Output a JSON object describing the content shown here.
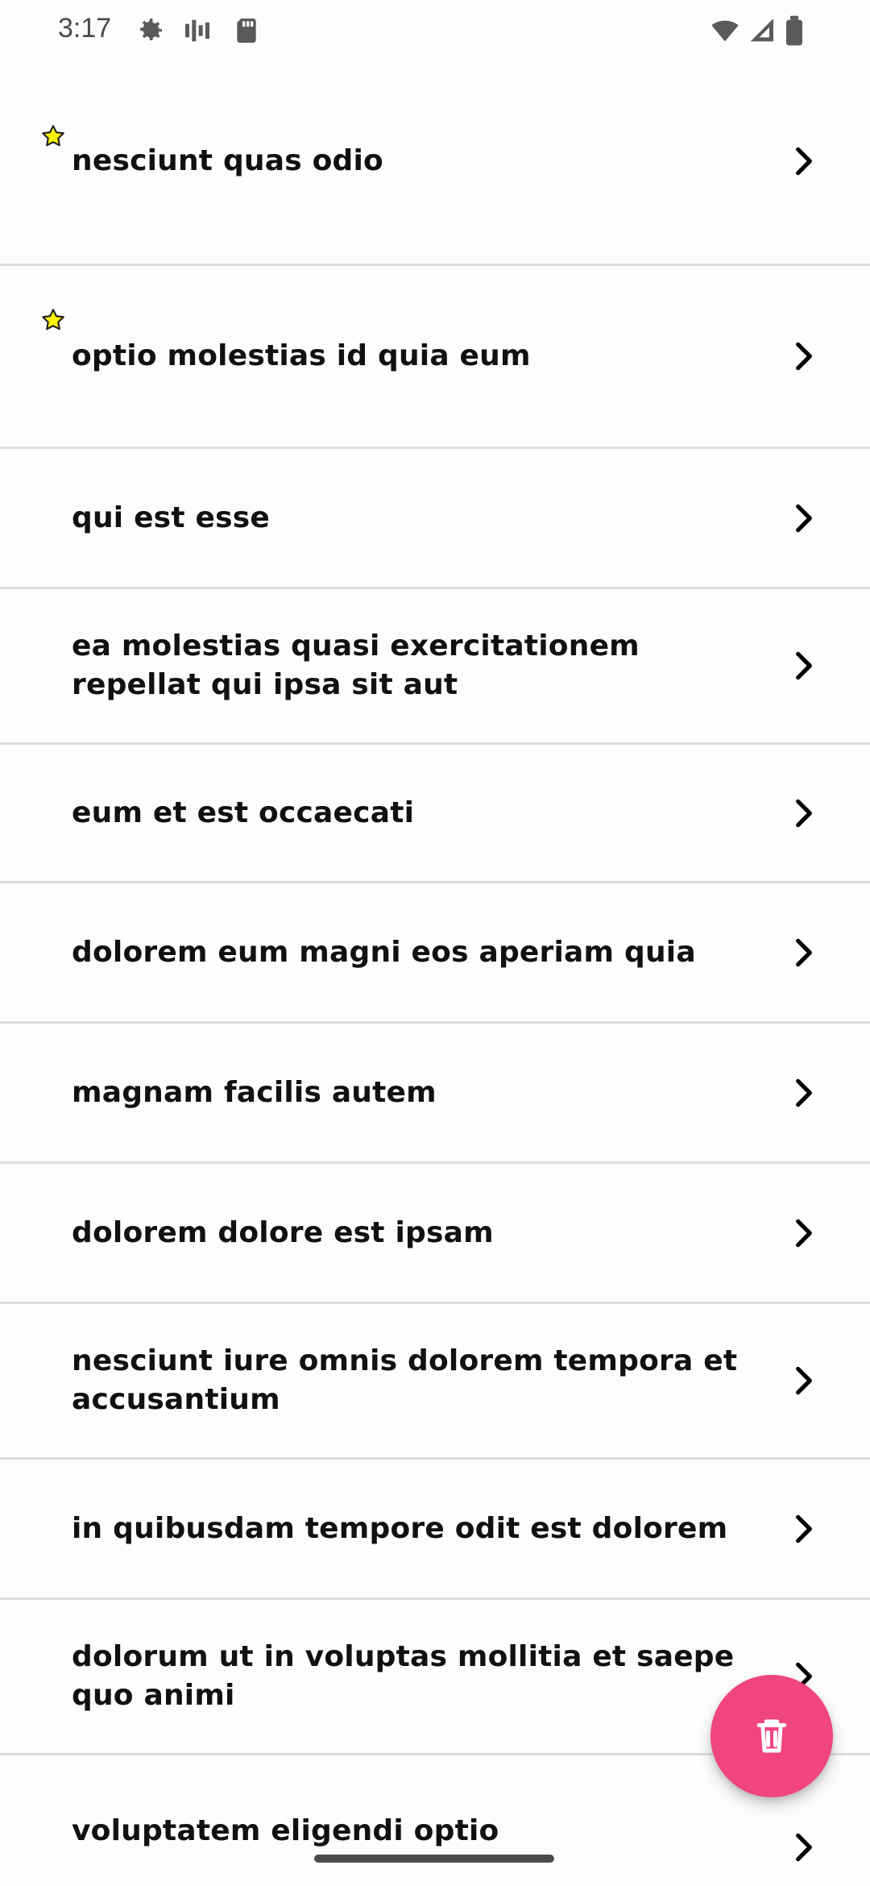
{
  "status_bar": {
    "time": "3:17",
    "left_icons": [
      "settings-icon",
      "signal-bars-icon",
      "sd-card-icon"
    ],
    "right_icons": [
      "wifi-icon",
      "cellular-icon",
      "battery-icon"
    ]
  },
  "list": {
    "items": [
      {
        "title": "nesciunt quas odio",
        "starred": true
      },
      {
        "title": "optio molestias id quia eum",
        "starred": true
      },
      {
        "title": "qui est esse",
        "starred": false
      },
      {
        "title": "ea molestias quasi exercitationem repellat qui ipsa sit aut",
        "starred": false
      },
      {
        "title": "eum et est occaecati",
        "starred": false
      },
      {
        "title": "dolorem eum magni eos aperiam quia",
        "starred": false
      },
      {
        "title": "magnam facilis autem",
        "starred": false
      },
      {
        "title": "dolorem dolore est ipsam",
        "starred": false
      },
      {
        "title": "nesciunt iure omnis dolorem tempora et accusantium",
        "starred": false
      },
      {
        "title": "in quibusdam tempore odit est dolorem",
        "starred": false
      },
      {
        "title": "dolorum ut in voluptas mollitia et saepe quo animi",
        "starred": false
      },
      {
        "title": "voluptatem eligendi optio",
        "starred": false
      }
    ]
  },
  "fab": {
    "icon": "trash-icon",
    "color": "#f0457f"
  },
  "colors": {
    "background": "#fdfdfe",
    "divider": "#dcdde2",
    "star_fill": "#f9f20a",
    "star_outline": "#1f1f1f",
    "text": "#111111"
  }
}
